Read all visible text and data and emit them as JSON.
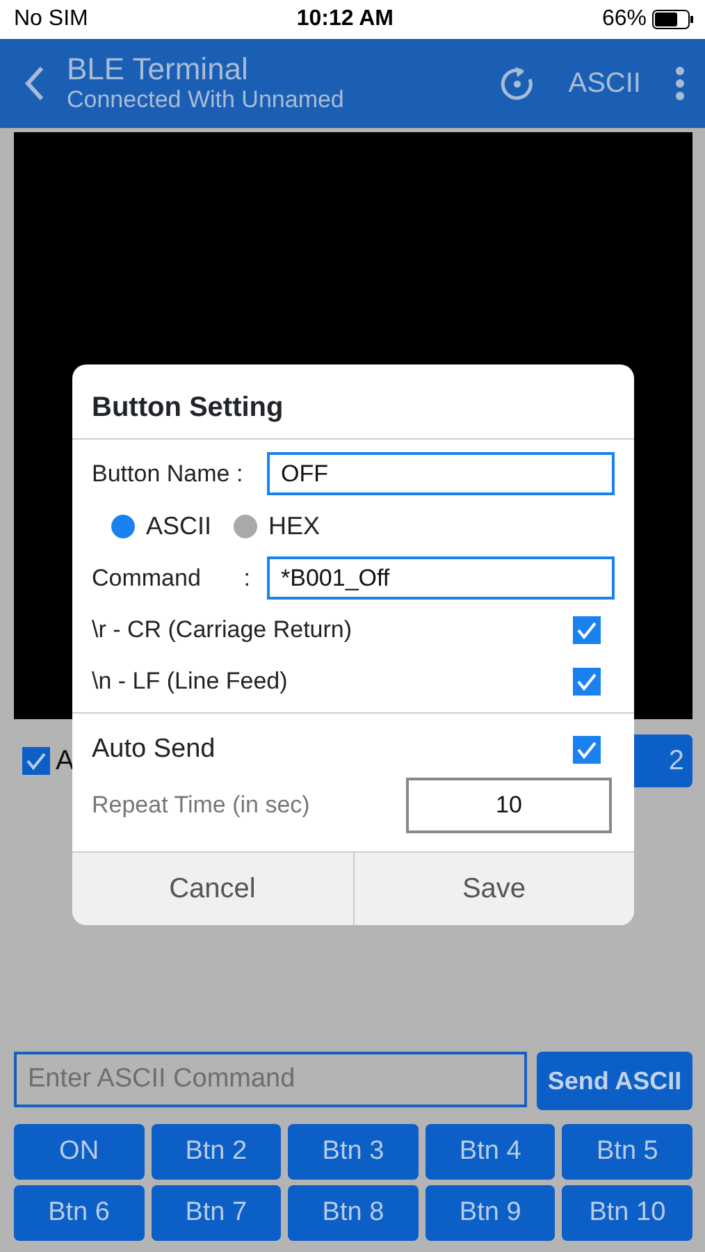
{
  "status_bar": {
    "carrier": "No SIM",
    "time": "10:12 AM",
    "battery": "66%"
  },
  "header": {
    "title": "BLE Terminal",
    "subtitle": "Connected With Unnamed",
    "mode": "ASCII"
  },
  "background_row": {
    "checkbox": {
      "label": "A",
      "checked": true
    },
    "button": "2"
  },
  "dialog": {
    "title": "Button Setting",
    "name_label": "Button Name :",
    "name_value": "OFF",
    "formats": [
      {
        "label": "ASCII",
        "selected": true
      },
      {
        "label": "HEX",
        "selected": false
      }
    ],
    "command_label": "Command",
    "command_colon": ":",
    "command_value": "*B001_Off",
    "options": [
      {
        "label": "\\r - CR (Carriage Return)",
        "checked": true
      },
      {
        "label": "\\n - LF (Line Feed)",
        "checked": true
      }
    ],
    "auto_send": {
      "label": "Auto Send",
      "checked": true
    },
    "repeat": {
      "label": "Repeat Time (in sec)",
      "value": "10"
    },
    "buttons": [
      "Cancel",
      "Save"
    ]
  },
  "command_input": {
    "placeholder": "Enter ASCII Command"
  },
  "send_button": "Send ASCII",
  "quick_buttons": [
    "ON",
    "Btn 2",
    "Btn 3",
    "Btn 4",
    "Btn 5",
    "Btn 6",
    "Btn 7",
    "Btn 8",
    "Btn 9",
    "Btn 10"
  ]
}
